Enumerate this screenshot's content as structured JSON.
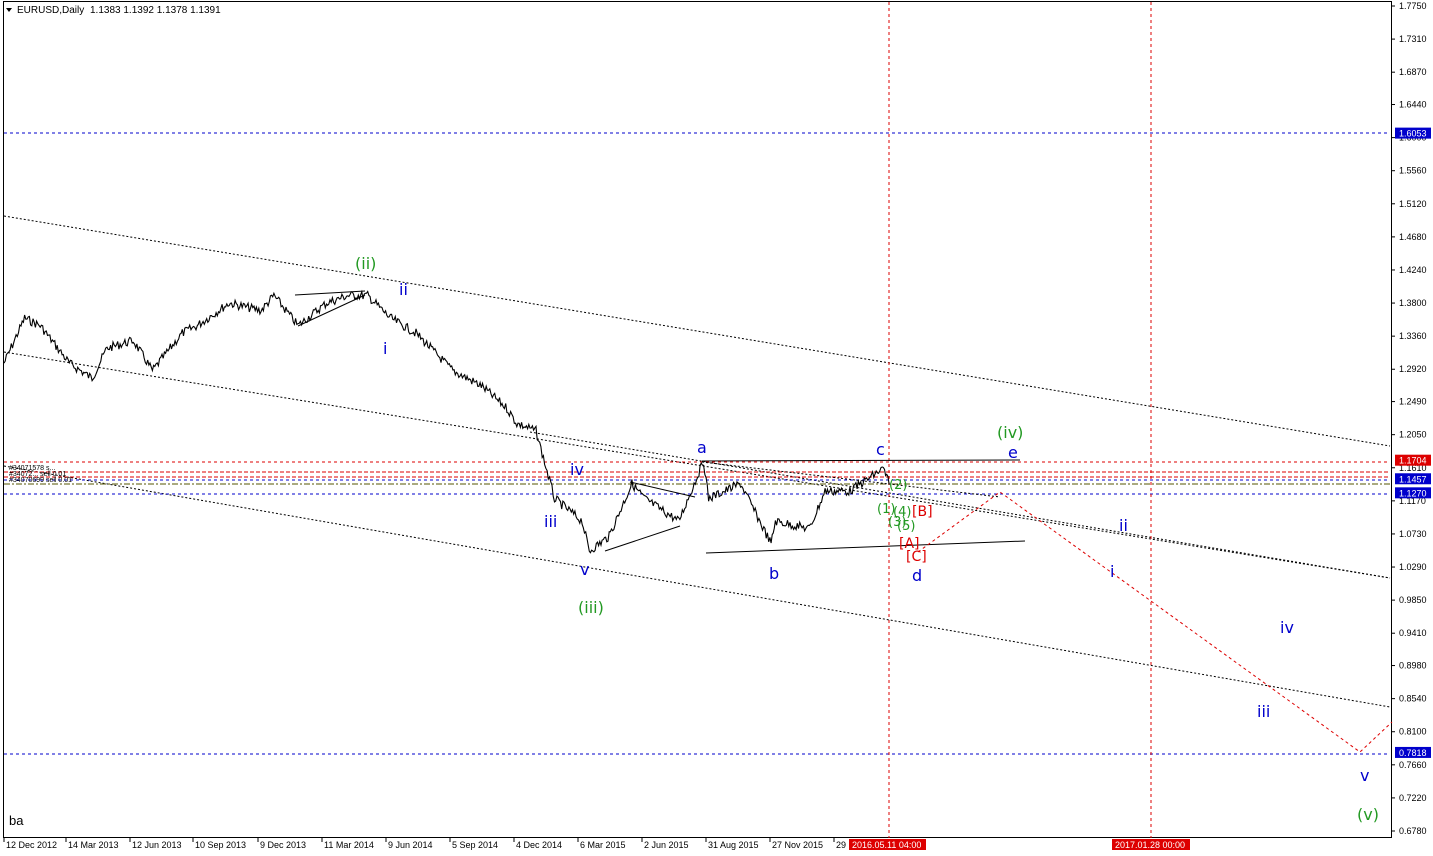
{
  "header": {
    "symbol": "EURUSD,Daily",
    "ohlc": "1.1383 1.1392 1.1378 1.1391"
  },
  "corner_label": "ba",
  "order_labels": [
    "#34071578 s...",
    "#34072... sell 0.01",
    "#34070699 sell 0.01"
  ],
  "price_badges": [
    {
      "label": "1.6053",
      "price": 1.6053,
      "color": "#0000cc"
    },
    {
      "label": "1.1704",
      "price": 1.1704,
      "color": "#dd0000"
    },
    {
      "label": "1.1457",
      "price": 1.1457,
      "color": "#0000cc"
    },
    {
      "label": "1.1270",
      "price": 1.127,
      "color": "#0000cc"
    },
    {
      "label": "0.7818",
      "price": 0.7818,
      "color": "#0000cc"
    }
  ],
  "date_badges": [
    {
      "label": "2016.05.11 04:00",
      "color": "#dd0000"
    },
    {
      "label": "2017.01.28 00:00",
      "color": "#dd0000"
    }
  ],
  "wave_labels": [
    {
      "text": "(ii)",
      "color": "#229922"
    },
    {
      "text": "ii",
      "color": "#0000cc"
    },
    {
      "text": "i",
      "color": "#0000cc"
    },
    {
      "text": "iv",
      "color": "#0000cc"
    },
    {
      "text": "iii",
      "color": "#0000cc"
    },
    {
      "text": "v",
      "color": "#0000cc"
    },
    {
      "text": "(iii)",
      "color": "#229922"
    },
    {
      "text": "a",
      "color": "#0000cc"
    },
    {
      "text": "b",
      "color": "#0000cc"
    },
    {
      "text": "c",
      "color": "#0000cc"
    },
    {
      "text": "d",
      "color": "#0000cc"
    },
    {
      "text": "e",
      "color": "#0000cc"
    },
    {
      "text": "(iv)",
      "color": "#229922"
    },
    {
      "text": "(2)",
      "color": "#229922"
    },
    {
      "text": "(1)",
      "color": "#229922"
    },
    {
      "text": "(4)",
      "color": "#229922"
    },
    {
      "text": "(3)",
      "color": "#229922"
    },
    {
      "text": "(5)",
      "color": "#229922"
    },
    {
      "text": "[B]",
      "color": "#dd0000"
    },
    {
      "text": "[A]",
      "color": "#dd0000"
    },
    {
      "text": "[C]",
      "color": "#dd0000"
    },
    {
      "text": "ii",
      "color": "#0000cc"
    },
    {
      "text": "i",
      "color": "#0000cc"
    },
    {
      "text": "iv",
      "color": "#0000cc"
    },
    {
      "text": "iii",
      "color": "#0000cc"
    },
    {
      "text": "v",
      "color": "#0000cc"
    },
    {
      "text": "(v)",
      "color": "#229922"
    }
  ],
  "chart_data": {
    "type": "line",
    "title": "EURUSD,Daily",
    "series": [
      {
        "x": [
          "2012-12-12",
          "2013-01-10",
          "2013-02-01",
          "2013-03-14",
          "2013-04-15",
          "2013-05-06",
          "2013-06-12",
          "2013-07-09",
          "2013-08-20",
          "2013-09-10",
          "2013-10-25",
          "2013-12-09",
          "2013-12-27",
          "2014-01-30",
          "2014-03-11",
          "2014-04-10",
          "2014-05-08",
          "2014-06-09",
          "2014-07-15",
          "2014-09-05",
          "2014-10-15",
          "2014-11-20",
          "2014-12-04",
          "2014-12-31",
          "2015-01-26",
          "2015-03-06",
          "2015-03-16",
          "2015-04-13",
          "2015-05-15",
          "2015-06-02",
          "2015-07-20",
          "2015-08-24",
          "2015-08-31",
          "2015-10-15",
          "2015-11-27",
          "2015-12-03",
          "2016-01-20",
          "2016-02-11",
          "2016-03-17",
          "2016-05-03",
          "2016-05-11"
        ],
        "values": [
          1.3,
          1.36,
          1.35,
          1.3,
          1.28,
          1.32,
          1.33,
          1.29,
          1.34,
          1.35,
          1.38,
          1.37,
          1.39,
          1.35,
          1.38,
          1.39,
          1.39,
          1.36,
          1.34,
          1.29,
          1.27,
          1.24,
          1.22,
          1.21,
          1.12,
          1.09,
          1.05,
          1.07,
          1.14,
          1.12,
          1.09,
          1.17,
          1.12,
          1.14,
          1.06,
          1.09,
          1.08,
          1.13,
          1.13,
          1.16,
          1.14
        ]
      }
    ],
    "x_ticks": [
      "12 Dec 2012",
      "14 Mar 2013",
      "12 Jun 2013",
      "10 Sep 2013",
      "9 Dec 2013",
      "11 Mar 2014",
      "9 Jun 2014",
      "5 Sep 2014",
      "4 Dec 2014",
      "6 Mar 2015",
      "2 Jun 2015",
      "31 Aug 2015",
      "27 Nov 2015",
      "29"
    ],
    "y_ticks": [
      "1.7750",
      "1.7310",
      "1.6870",
      "1.6440",
      "1.6000",
      "1.5560",
      "1.5120",
      "1.4680",
      "1.4240",
      "1.3800",
      "1.3360",
      "1.2920",
      "1.2490",
      "1.2050",
      "1.1610",
      "1.1170",
      "1.0730",
      "1.0290",
      "0.9850",
      "0.9410",
      "0.8980",
      "0.8540",
      "0.8100",
      "0.7660",
      "0.7220",
      "0.6780"
    ],
    "ylim": [
      0.67,
      1.785
    ],
    "grid": false
  }
}
